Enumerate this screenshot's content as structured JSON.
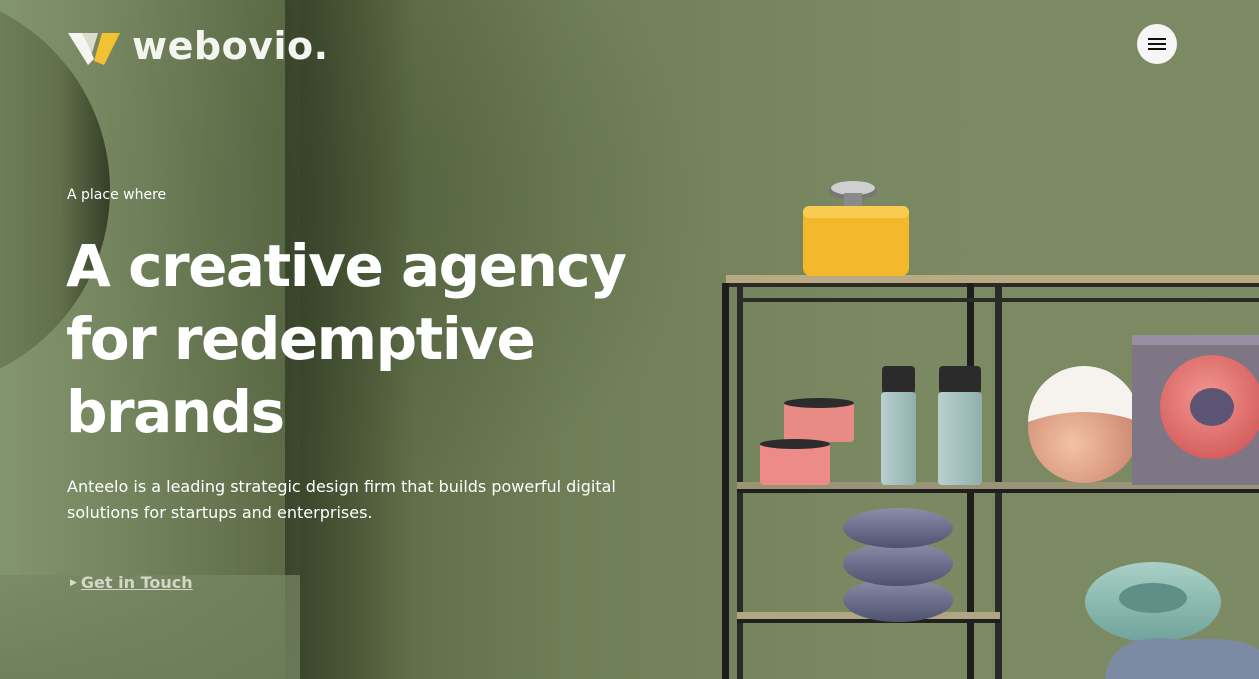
{
  "brand": {
    "name": "webovio."
  },
  "menu": {
    "icon": "hamburger-menu-icon"
  },
  "hero": {
    "eyebrow": "A place where",
    "headline_line1": "A creative agency",
    "headline_line2": "for redemptive",
    "headline_line3": "brands",
    "description": "Anteelo is a leading strategic design firm that builds powerful digital solutions for startups and enterprises.",
    "cta_label": "Get in Touch",
    "cta_icon": "play-arrow-icon"
  },
  "colors": {
    "background": "#7a8862",
    "text": "#ffffff",
    "logo_yellow": "#f2c230",
    "logo_white": "#f4f4f0"
  }
}
